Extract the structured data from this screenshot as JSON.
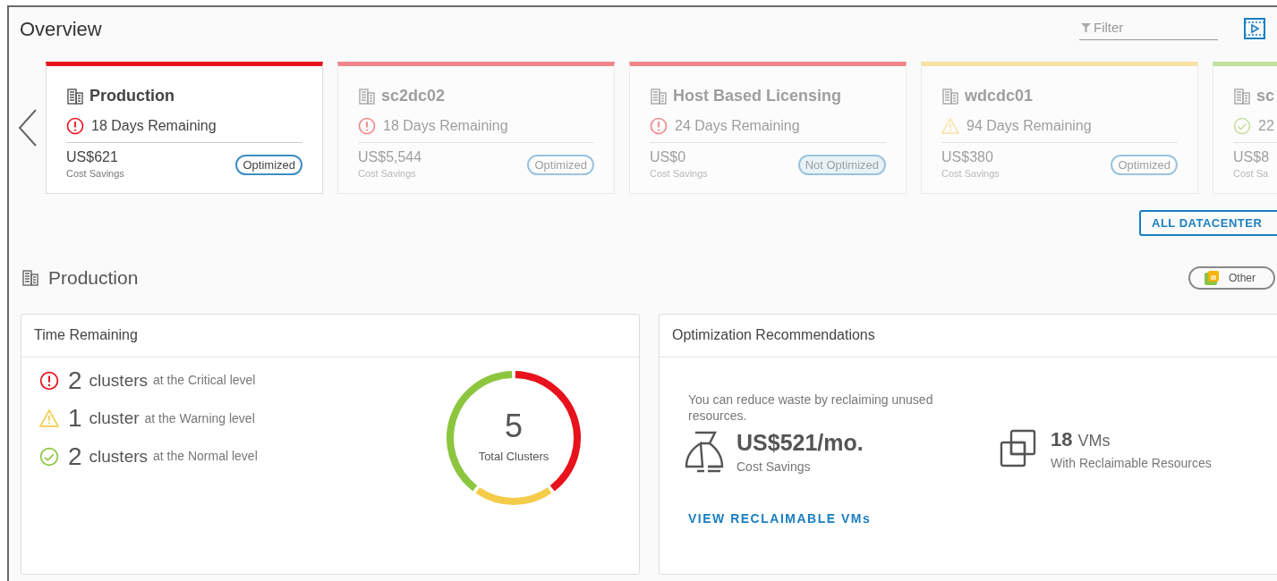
{
  "title": "Overview",
  "filter": {
    "placeholder": "Filter"
  },
  "cards": [
    {
      "name": "Production",
      "kind": "critical",
      "remaining": "18 Days Remaining",
      "savings": "US$621",
      "savings_label": "Cost Savings",
      "badge": "Optimized",
      "optimized": true,
      "selected": true
    },
    {
      "name": "sc2dc02",
      "kind": "critical",
      "remaining": "18 Days Remaining",
      "savings": "US$5,544",
      "savings_label": "Cost Savings",
      "badge": "Optimized",
      "optimized": true,
      "selected": false
    },
    {
      "name": "Host Based Licensing",
      "kind": "critical",
      "remaining": "24 Days Remaining",
      "savings": "US$0",
      "savings_label": "Cost Savings",
      "badge": "Not Optimized",
      "optimized": false,
      "selected": false
    },
    {
      "name": "wdcdc01",
      "kind": "warning",
      "remaining": "94 Days Remaining",
      "savings": "US$380",
      "savings_label": "Cost Savings",
      "badge": "Optimized",
      "optimized": true,
      "selected": false
    },
    {
      "name": "sc",
      "kind": "normal",
      "remaining": "22",
      "savings": "US$8",
      "savings_label": "Cost Sa",
      "selected": false
    }
  ],
  "all_button": "ALL DATACENTER",
  "section": {
    "title": "Production",
    "tag": "Other"
  },
  "time_panel": {
    "title": "Time Remaining",
    "total": "5",
    "total_label": "Total Clusters",
    "levels": [
      {
        "kind": "critical",
        "count": "2",
        "unit": "clusters",
        "text": "at the Critical level"
      },
      {
        "kind": "warning",
        "count": "1",
        "unit": "cluster",
        "text": "at the Warning level"
      },
      {
        "kind": "normal",
        "count": "2",
        "unit": "clusters",
        "text": "at the Normal level"
      }
    ]
  },
  "opt_panel": {
    "title": "Optimization Recommendations",
    "intro": "You can reduce waste by reclaiming unused resources.",
    "cost": "US$521/mo.",
    "cost_label": "Cost Savings",
    "vms_count": "18",
    "vms_unit": "VMs",
    "vms_label": "With Reclaimable Resources",
    "link": "VIEW RECLAIMABLE VMs"
  }
}
